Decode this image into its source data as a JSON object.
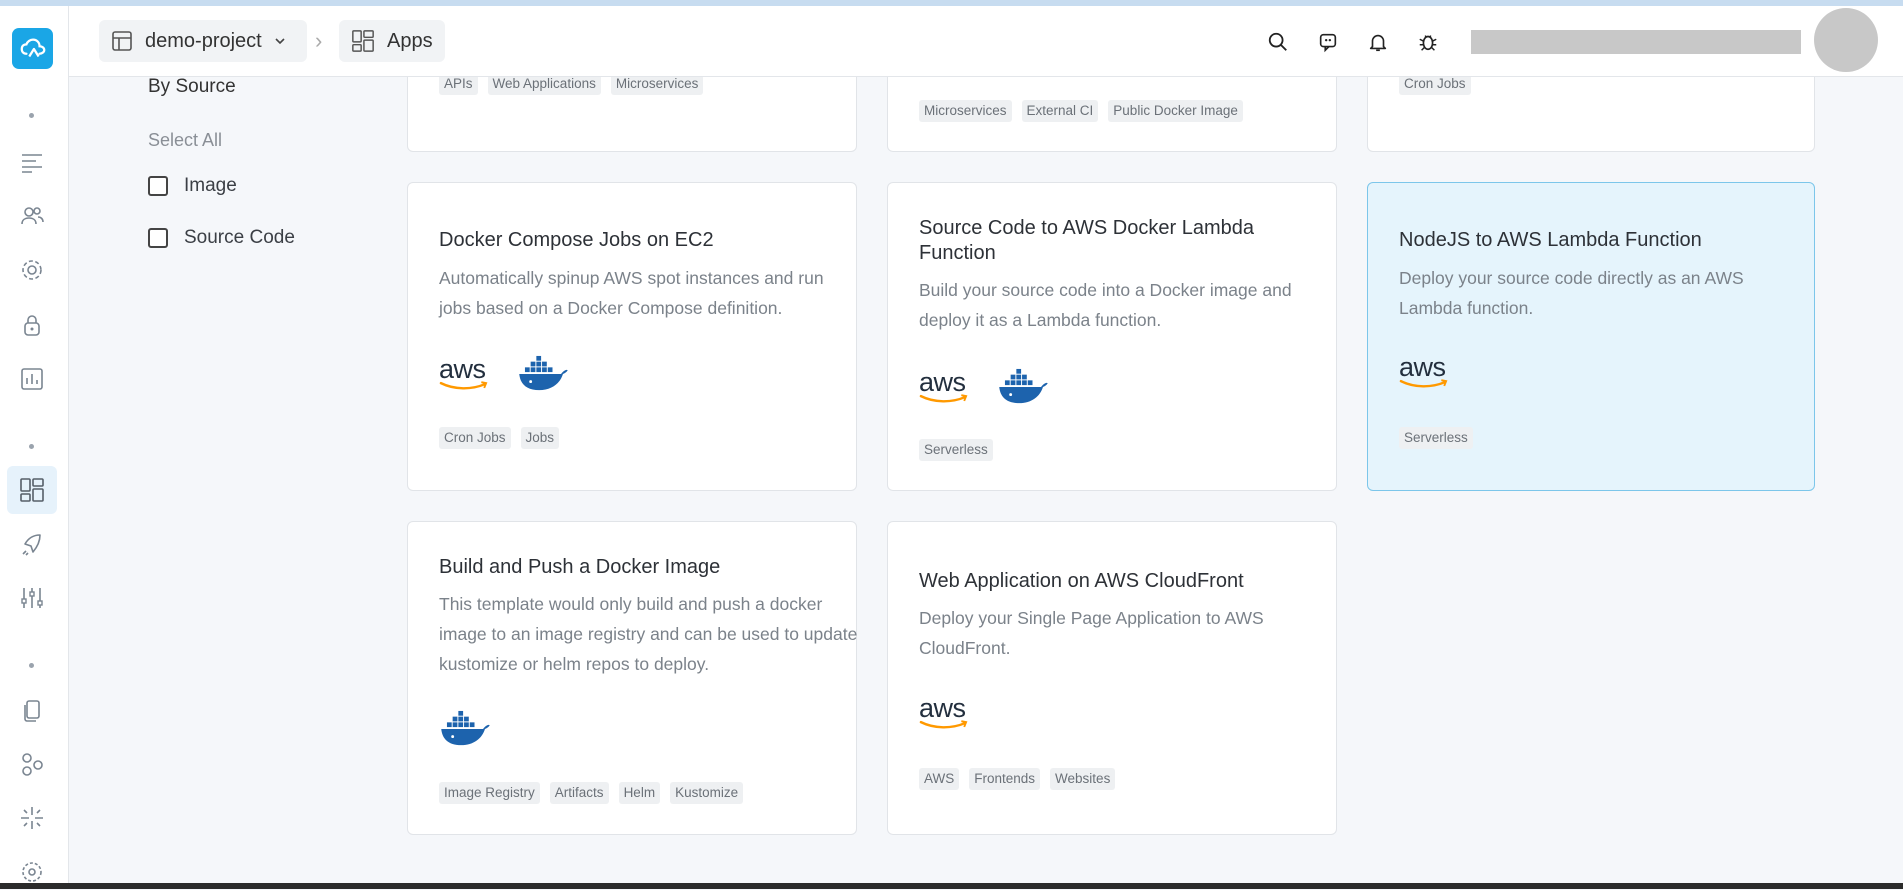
{
  "header": {
    "project": "demo-project",
    "section": "Apps"
  },
  "filters": {
    "title": "By Source",
    "select_all": "Select All",
    "options": [
      "Image",
      "Source Code"
    ]
  },
  "cards_top_partial": [
    {
      "tags": [
        "APIs",
        "Web Applications",
        "Microservices"
      ]
    },
    {
      "tags": [
        "Microservices",
        "External CI",
        "Public Docker Image"
      ]
    },
    {
      "tags": [
        "Cron Jobs"
      ]
    }
  ],
  "cards": [
    {
      "title": "Docker Compose Jobs on EC2",
      "description": "Automatically spinup AWS spot instances and run jobs based on a Docker Compose definition.",
      "logos": [
        "aws-logo",
        "docker-logo"
      ],
      "tags": [
        "Cron Jobs",
        "Jobs"
      ]
    },
    {
      "title": "Source Code to AWS Docker Lambda Function",
      "description": "Build your source code into a Docker image and deploy it as a Lambda function.",
      "logos": [
        "aws-logo",
        "docker-logo"
      ],
      "tags": [
        "Serverless"
      ]
    },
    {
      "title": "NodeJS to AWS Lambda Function",
      "description": "Deploy your source code directly as an AWS Lambda function.",
      "logos": [
        "aws-logo"
      ],
      "tags": [
        "Serverless"
      ]
    },
    {
      "title": "Build and Push a Docker Image",
      "description": "This template would only build and push a docker image to an image registry and can be used to update kustomize or helm repos to deploy.",
      "logos": [
        "docker-logo"
      ],
      "tags": [
        "Image Registry",
        "Artifacts",
        "Helm",
        "Kustomize"
      ]
    },
    {
      "title": "Web Application on AWS CloudFront",
      "description": "Deploy your Single Page Application to AWS CloudFront.",
      "logos": [
        "aws-logo"
      ],
      "tags": [
        "AWS",
        "Frontends",
        "Websites"
      ]
    }
  ],
  "logo_text": {
    "aws": "aws"
  },
  "colors": {
    "brand": "#1aa6e6",
    "selected_card_bg": "#e5f4fc",
    "selected_card_border": "#7cc6ea",
    "aws_orange": "#ff9900",
    "docker_blue": "#1d63ad"
  }
}
